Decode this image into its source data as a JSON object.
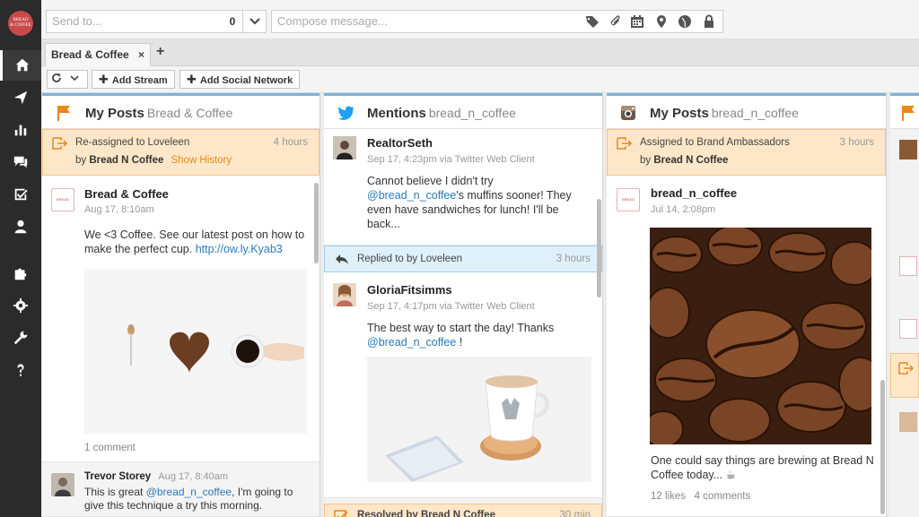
{
  "brand": {
    "logo_text": "BREAD & COFFEE"
  },
  "composer": {
    "send_to_placeholder": "Send to...",
    "send_to_count": "0",
    "compose_placeholder": "Compose message..."
  },
  "tabs": [
    {
      "label": "Bread & Coffee",
      "close": "×"
    }
  ],
  "tab_add": "+",
  "toolbar": {
    "add_stream": "Add Stream",
    "add_social_network": "Add Social Network"
  },
  "columns": [
    {
      "title": "My Posts",
      "subtitle": "Bread & Coffee",
      "banner": {
        "text": "Re-assigned to Loveleen",
        "by_prefix": "by",
        "by": "Bread N Coffee",
        "link": "Show History",
        "time": "4 hours"
      },
      "posts": [
        {
          "author": "Bread & Coffee",
          "time": "Aug 17, 8:10am",
          "text": "We <3 Coffee. See our latest post on how to make the perfect cup.",
          "link": "http://ow.ly.Kyab3",
          "comments": "1 comment"
        }
      ],
      "comment": {
        "author": "Trevor Storey",
        "time": "Aug 17, 8:40am",
        "text_pre": "This is great",
        "mention": "@bread_n_coffee",
        "text_post": ", I'm going to give this technique a try this morning."
      }
    },
    {
      "title": "Mentions",
      "subtitle": "bread_n_coffee",
      "posts": [
        {
          "author": "RealtorSeth",
          "time": "Sep 17, 4:23pm via Twitter Web Client",
          "text_pre": "Cannot believe I didn't try",
          "mention": "@bread_n_coffee",
          "text_post": "'s muffins sooner! They even have sandwiches for lunch! I'll be back..."
        },
        {
          "author": "GloriaFitsimms",
          "time": "Sep 17, 4:17pm via Twitter Web Client",
          "text_pre": "The best way to start the day! Thanks",
          "mention": "@bread_n_coffee",
          "text_post": " !"
        }
      ],
      "replied_banner": {
        "text": "Replied to by Loveleen",
        "time": "3 hours"
      },
      "resolved_banner": {
        "text": "Resolved by Bread N Coffee",
        "time": "30 min"
      }
    },
    {
      "title": "My Posts",
      "subtitle": "bread_n_coffee",
      "banner": {
        "text": "Assigned to Brand Ambassadors",
        "by_prefix": "by",
        "by": "Bread N Coffee",
        "time": "3 hours"
      },
      "posts": [
        {
          "author": "bread_n_coffee",
          "time": "Jul 14, 2:08pm",
          "text": "One could say things are brewing at Bread N Coffee today... ☕",
          "likes": "12 likes",
          "comments": "4 comments"
        }
      ]
    }
  ],
  "colors": {
    "sidebar_bg": "#2b2b2b",
    "banner_orange": "#fde7c8",
    "banner_blue": "#dff0fa",
    "link": "#2a7ab8",
    "accent_orange": "#e8891a",
    "twitter_blue": "#1da1f2"
  },
  "sidebar_icons": [
    "home-icon",
    "send-icon",
    "analytics-icon",
    "assignments-icon",
    "tasks-icon",
    "contacts-icon",
    "apps-icon",
    "settings-icon",
    "tools-icon",
    "help-icon"
  ]
}
